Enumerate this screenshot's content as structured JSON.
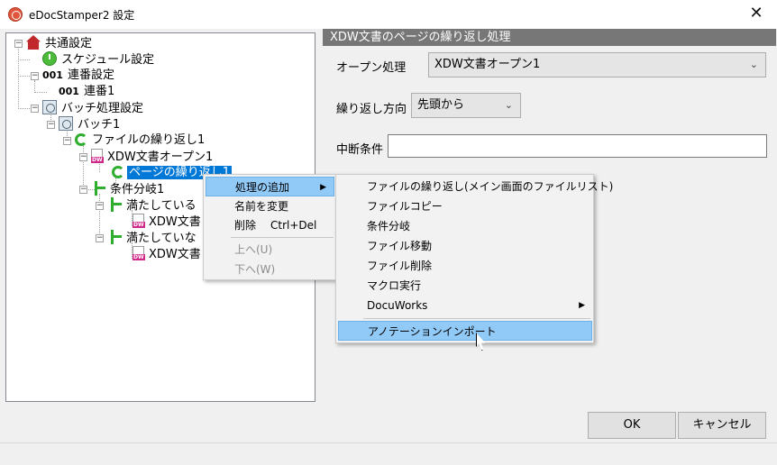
{
  "window": {
    "title": "eDocStamper2 設定",
    "close_glyph": "✕"
  },
  "tree": {
    "common": "共通設定",
    "schedule": "スケジュール設定",
    "serial_num_icon": "001",
    "serial": "連番設定",
    "serial1": "連番1",
    "batch_settings": "バッチ処理設定",
    "batch1": "バッチ1",
    "file_loop": "ファイルの繰り返し1",
    "xdw_open": "XDW文書オープン1",
    "page_loop": "ページの繰り返し1",
    "branch": "条件分岐1",
    "satisfied": "満たしている",
    "xdw_doc_a": "XDW文書",
    "not_satisfied": "満たしていな",
    "xdw_doc_b": "XDW文書"
  },
  "panel": {
    "header": "XDW文書のページの繰り返し処理",
    "open_label": "オープン処理",
    "open_value": "XDW文書オープン1",
    "direction_label": "繰り返し方向",
    "direction_value": "先頭から",
    "stop_label": "中断条件",
    "stop_value": ""
  },
  "context_menu": {
    "add": "処理の追加",
    "rename": "名前を変更",
    "delete": "削除",
    "delete_shortcut": "Ctrl+Del",
    "up": "上へ(U)",
    "down": "下へ(W)"
  },
  "submenu": {
    "items": [
      "ファイルの繰り返し(メイン画面のファイルリスト)",
      "ファイルコピー",
      "条件分岐",
      "ファイル移動",
      "ファイル削除",
      "マクロ実行",
      "DocuWorks",
      "アノテーションインポート"
    ]
  },
  "buttons": {
    "ok": "OK",
    "cancel": "キャンセル"
  },
  "colors": {
    "selection": "#0078d7",
    "menu_highlight": "#91c9f7",
    "panel_header": "#777777"
  },
  "icons": [
    "app-icon",
    "close-icon",
    "house-icon",
    "clock-icon",
    "batch-icon",
    "loop-icon",
    "xdw-document-icon",
    "branch-icon",
    "submenu-arrow-icon",
    "chevron-down-icon",
    "mouse-cursor-icon"
  ]
}
